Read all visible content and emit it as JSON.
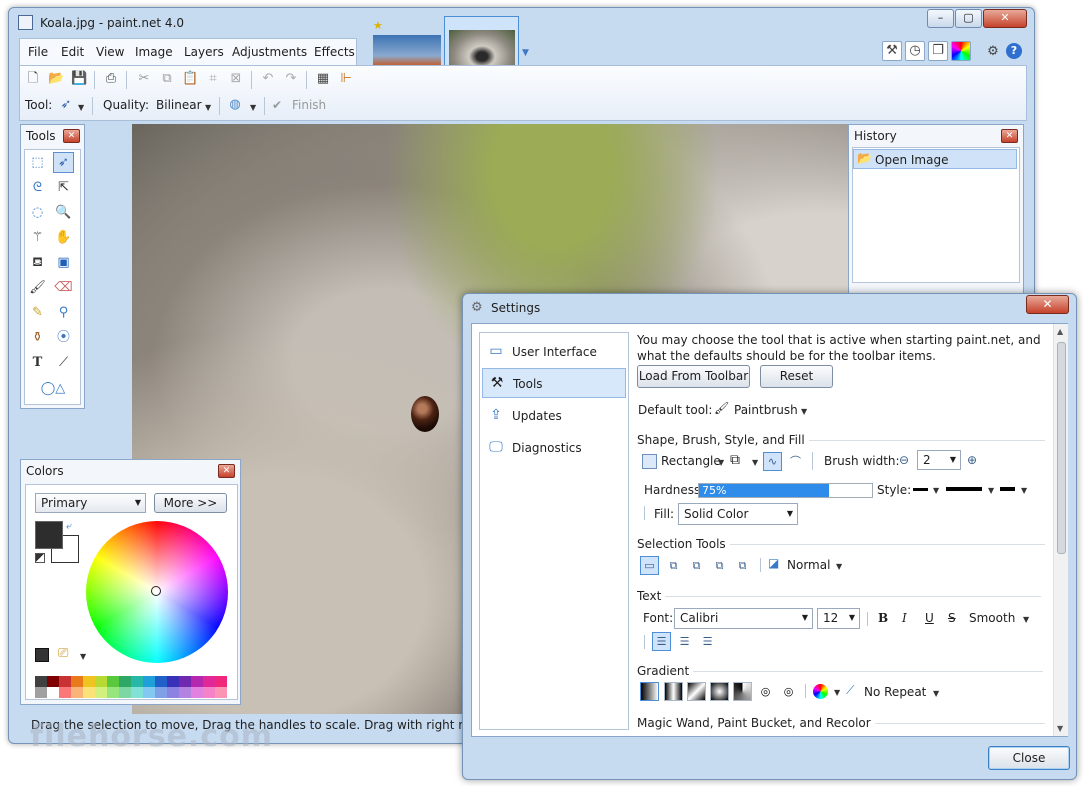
{
  "window": {
    "title": "Koala.jpg - paint.net 4.0"
  },
  "menu": [
    "File",
    "Edit",
    "View",
    "Image",
    "Layers",
    "Adjustments",
    "Effects"
  ],
  "toolbar": {
    "tool_label": "Tool:",
    "quality_label": "Quality:",
    "quality_value": "Bilinear",
    "finish_label": "Finish"
  },
  "tools_panel": {
    "title": "Tools"
  },
  "history_panel": {
    "title": "History",
    "items": [
      "Open Image"
    ]
  },
  "colors_panel": {
    "title": "Colors",
    "mode": "Primary",
    "more_button": "More >>",
    "primary_color": "#2d2d2d",
    "secondary_color": "#ffffff"
  },
  "status": {
    "text": "Drag the selection to move, Drag the handles to scale. Drag with right mouse button"
  },
  "settings": {
    "title": "Settings",
    "nav": [
      "User Interface",
      "Tools",
      "Updates",
      "Diagnostics"
    ],
    "selected_nav": "Tools",
    "description": "You may choose the tool that is active when starting paint.net, and what the defaults should be for the toolbar items.",
    "load_button": "Load From Toolbar",
    "reset_button": "Reset",
    "default_tool_label": "Default tool:",
    "default_tool_value": "Paintbrush",
    "shape_section": "Shape, Brush, Style, and Fill",
    "shape_value": "Rectangle",
    "brush_width_label": "Brush width:",
    "brush_width_value": "2",
    "hardness_label": "Hardness:",
    "hardness_value": "75%",
    "hardness_fraction": 0.75,
    "style_label": "Style:",
    "fill_label": "Fill:",
    "fill_value": "Solid Color",
    "selection_section": "Selection Tools",
    "selection_mode": "Normal",
    "text_section": "Text",
    "font_label": "Font:",
    "font_value": "Calibri",
    "font_size": "12",
    "bold": "B",
    "italic": "I",
    "underline": "U",
    "strike": "S",
    "smoothing": "Smooth",
    "gradient_section": "Gradient",
    "repeat_value": "No Repeat",
    "magic_section": "Magic Wand, Paint Bucket, and Recolor",
    "close_button": "Close"
  },
  "watermark": "filehorse.com"
}
